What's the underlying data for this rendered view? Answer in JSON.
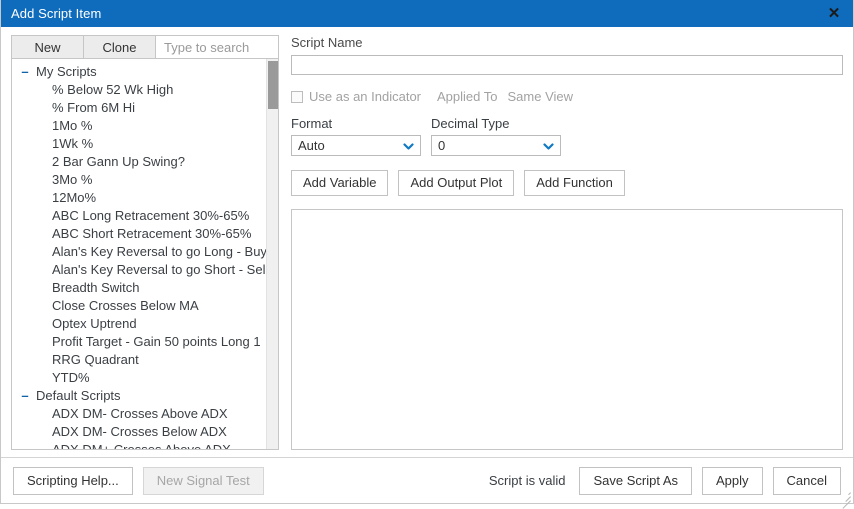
{
  "window": {
    "title": "Add Script Item",
    "close_label": "✕",
    "accent_color": "#0f6cbd",
    "title_text_color": "#ffffff"
  },
  "left_panel": {
    "tabs": [
      {
        "label": "New"
      },
      {
        "label": "Clone"
      }
    ],
    "search": {
      "placeholder": "Type to search",
      "value": ""
    },
    "tree": {
      "collapse_icon": "–",
      "groups": [
        {
          "label": "My Scripts",
          "expanded": true,
          "items": [
            "% Below 52 Wk High",
            "% From 6M Hi",
            "1Mo %",
            "1Wk %",
            "2 Bar Gann Up Swing?",
            "3Mo %",
            "12Mo%",
            "ABC Long Retracement 30%-65%",
            "ABC Short Retracement 30%-65%",
            "Alan's Key Reversal to go Long - Buy",
            "Alan's Key Reversal to go Short - Sell",
            "Breadth Switch",
            "Close Crosses Below MA",
            "Optex Uptrend",
            "Profit Target - Gain 50 points Long 1",
            "RRG Quadrant",
            "YTD%"
          ]
        },
        {
          "label": "Default Scripts",
          "expanded": true,
          "items": [
            "ADX DM- Crosses Above ADX",
            "ADX DM- Crosses Below ADX",
            "ADX DM+ Crosses Above ADX"
          ]
        }
      ]
    }
  },
  "right_panel": {
    "script_name": {
      "label": "Script Name",
      "value": "",
      "placeholder": ""
    },
    "indicator_option": {
      "checkbox_label": "Use as an Indicator",
      "checked": false,
      "applied_to_label": "Applied To",
      "same_view_label": "Same View"
    },
    "format": {
      "label": "Format",
      "value": "Auto"
    },
    "decimal_type": {
      "label": "Decimal Type",
      "value": "0"
    },
    "actions": [
      {
        "label": "Add Variable"
      },
      {
        "label": "Add Output Plot"
      },
      {
        "label": "Add Function"
      }
    ],
    "editor": {
      "value": "",
      "placeholder": ""
    }
  },
  "footer": {
    "scripting_help_label": "Scripting Help...",
    "new_signal_test_label": "New Signal Test",
    "status_text": "Script is valid",
    "save_script_as_label": "Save Script As",
    "apply_label": "Apply",
    "cancel_label": "Cancel"
  }
}
